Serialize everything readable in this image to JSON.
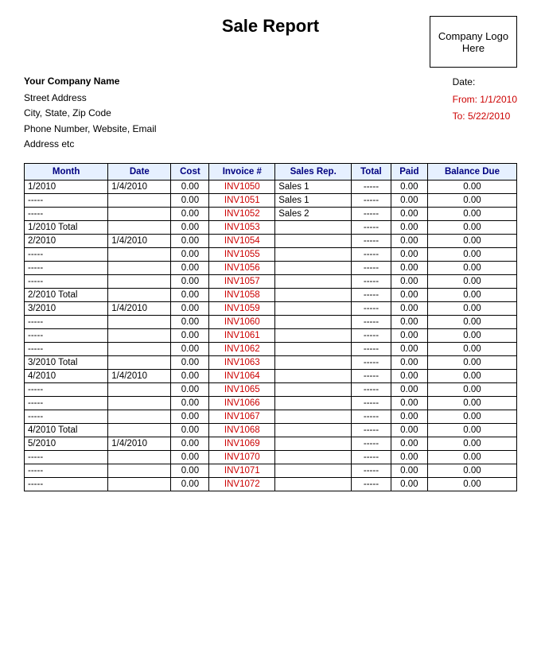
{
  "header": {
    "title": "Sale Report",
    "logo_text": "Company Logo Here"
  },
  "company": {
    "name": "Your Company Name",
    "street": "Street Address",
    "city": "City, State, Zip Code",
    "phone": "Phone Number, Website, Email",
    "address_etc": "Address etc",
    "date_label": "Date:",
    "from_label": "From: 1/1/2010",
    "to_label": "To: 5/22/2010"
  },
  "table": {
    "headers": [
      "Month",
      "Date",
      "Cost",
      "Invoice #",
      "Sales Rep.",
      "Total",
      "Paid",
      "Balance Due"
    ],
    "rows": [
      {
        "month": "1/2010",
        "date": "1/4/2010",
        "cost": "0.00",
        "invoice": "INV1050",
        "sales_rep": "Sales 1",
        "total": "-----",
        "paid": "0.00",
        "balance": "0.00"
      },
      {
        "month": "-----",
        "date": "",
        "cost": "0.00",
        "invoice": "INV1051",
        "sales_rep": "Sales 1",
        "total": "-----",
        "paid": "0.00",
        "balance": "0.00"
      },
      {
        "month": "-----",
        "date": "",
        "cost": "0.00",
        "invoice": "INV1052",
        "sales_rep": "Sales 2",
        "total": "-----",
        "paid": "0.00",
        "balance": "0.00"
      },
      {
        "month": "1/2010 Total",
        "date": "",
        "cost": "0.00",
        "invoice": "INV1053",
        "sales_rep": "",
        "total": "-----",
        "paid": "0.00",
        "balance": "0.00"
      },
      {
        "month": "2/2010",
        "date": "1/4/2010",
        "cost": "0.00",
        "invoice": "INV1054",
        "sales_rep": "",
        "total": "-----",
        "paid": "0.00",
        "balance": "0.00"
      },
      {
        "month": "-----",
        "date": "",
        "cost": "0.00",
        "invoice": "INV1055",
        "sales_rep": "",
        "total": "-----",
        "paid": "0.00",
        "balance": "0.00"
      },
      {
        "month": "-----",
        "date": "",
        "cost": "0.00",
        "invoice": "INV1056",
        "sales_rep": "",
        "total": "-----",
        "paid": "0.00",
        "balance": "0.00"
      },
      {
        "month": "-----",
        "date": "",
        "cost": "0.00",
        "invoice": "INV1057",
        "sales_rep": "",
        "total": "-----",
        "paid": "0.00",
        "balance": "0.00"
      },
      {
        "month": "2/2010 Total",
        "date": "",
        "cost": "0.00",
        "invoice": "INV1058",
        "sales_rep": "",
        "total": "-----",
        "paid": "0.00",
        "balance": "0.00"
      },
      {
        "month": "3/2010",
        "date": "1/4/2010",
        "cost": "0.00",
        "invoice": "INV1059",
        "sales_rep": "",
        "total": "-----",
        "paid": "0.00",
        "balance": "0.00"
      },
      {
        "month": "-----",
        "date": "",
        "cost": "0.00",
        "invoice": "INV1060",
        "sales_rep": "",
        "total": "-----",
        "paid": "0.00",
        "balance": "0.00"
      },
      {
        "month": "-----",
        "date": "",
        "cost": "0.00",
        "invoice": "INV1061",
        "sales_rep": "",
        "total": "-----",
        "paid": "0.00",
        "balance": "0.00"
      },
      {
        "month": "-----",
        "date": "",
        "cost": "0.00",
        "invoice": "INV1062",
        "sales_rep": "",
        "total": "-----",
        "paid": "0.00",
        "balance": "0.00"
      },
      {
        "month": "3/2010 Total",
        "date": "",
        "cost": "0.00",
        "invoice": "INV1063",
        "sales_rep": "",
        "total": "-----",
        "paid": "0.00",
        "balance": "0.00"
      },
      {
        "month": "4/2010",
        "date": "1/4/2010",
        "cost": "0.00",
        "invoice": "INV1064",
        "sales_rep": "",
        "total": "-----",
        "paid": "0.00",
        "balance": "0.00"
      },
      {
        "month": "-----",
        "date": "",
        "cost": "0.00",
        "invoice": "INV1065",
        "sales_rep": "",
        "total": "-----",
        "paid": "0.00",
        "balance": "0.00"
      },
      {
        "month": "-----",
        "date": "",
        "cost": "0.00",
        "invoice": "INV1066",
        "sales_rep": "",
        "total": "-----",
        "paid": "0.00",
        "balance": "0.00"
      },
      {
        "month": "-----",
        "date": "",
        "cost": "0.00",
        "invoice": "INV1067",
        "sales_rep": "",
        "total": "-----",
        "paid": "0.00",
        "balance": "0.00"
      },
      {
        "month": "4/2010 Total",
        "date": "",
        "cost": "0.00",
        "invoice": "INV1068",
        "sales_rep": "",
        "total": "-----",
        "paid": "0.00",
        "balance": "0.00"
      },
      {
        "month": "5/2010",
        "date": "1/4/2010",
        "cost": "0.00",
        "invoice": "INV1069",
        "sales_rep": "",
        "total": "-----",
        "paid": "0.00",
        "balance": "0.00"
      },
      {
        "month": "-----",
        "date": "",
        "cost": "0.00",
        "invoice": "INV1070",
        "sales_rep": "",
        "total": "-----",
        "paid": "0.00",
        "balance": "0.00"
      },
      {
        "month": "-----",
        "date": "",
        "cost": "0.00",
        "invoice": "INV1071",
        "sales_rep": "",
        "total": "-----",
        "paid": "0.00",
        "balance": "0.00"
      },
      {
        "month": "-----",
        "date": "",
        "cost": "0.00",
        "invoice": "INV1072",
        "sales_rep": "",
        "total": "-----",
        "paid": "0.00",
        "balance": "0.00"
      }
    ]
  }
}
